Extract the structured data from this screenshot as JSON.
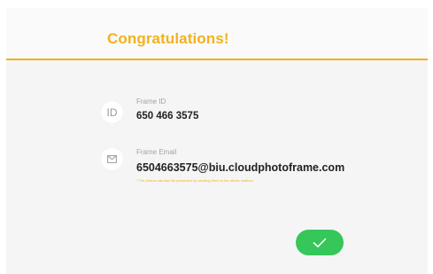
{
  "header": {
    "title": "Congratulations!"
  },
  "frame_id": {
    "icon_text": "ID",
    "label": "Frame ID",
    "value": "650 466 3575"
  },
  "frame_email": {
    "icon": "mail-icon",
    "label": "Frame Email",
    "value": "6504663575@biu.cloudphotoframe.com",
    "note": "* The photos can also be presented by sending them to the above mailbox."
  },
  "confirm_button": {
    "icon": "checkmark-icon"
  },
  "colors": {
    "accent": "#f3b11c",
    "confirm": "#35c759",
    "background": "#f5f5f5"
  }
}
